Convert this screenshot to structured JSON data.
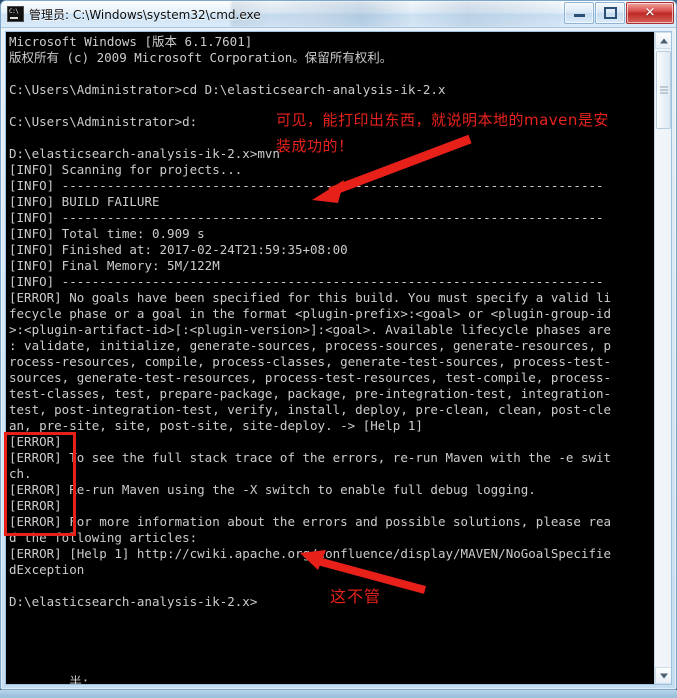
{
  "window": {
    "title": "管理员: C:\\Windows\\system32\\cmd.exe",
    "icon": "cmd-icon",
    "buttons": {
      "minimize": "—",
      "maximize": "□",
      "close": "✕"
    }
  },
  "console": {
    "lines": [
      "Microsoft Windows [版本 6.1.7601]",
      "版权所有 (c) 2009 Microsoft Corporation。保留所有权利。",
      "",
      "C:\\Users\\Administrator>cd D:\\elasticsearch-analysis-ik-2.x",
      "",
      "C:\\Users\\Administrator>d:",
      "",
      "D:\\elasticsearch-analysis-ik-2.x>mvn",
      "[INFO] Scanning for projects...",
      "[INFO] ------------------------------------------------------------------------",
      "[INFO] BUILD FAILURE",
      "[INFO] ------------------------------------------------------------------------",
      "[INFO] Total time: 0.909 s",
      "[INFO] Finished at: 2017-02-24T21:59:35+08:00",
      "[INFO] Final Memory: 5M/122M",
      "[INFO] ------------------------------------------------------------------------",
      "[ERROR] No goals have been specified for this build. You must specify a valid li",
      "fecycle phase or a goal in the format <plugin-prefix>:<goal> or <plugin-group-id",
      ">:<plugin-artifact-id>[:<plugin-version>]:<goal>. Available lifecycle phases are",
      ": validate, initialize, generate-sources, process-sources, generate-resources, p",
      "rocess-resources, compile, process-classes, generate-test-sources, process-test-",
      "sources, generate-test-resources, process-test-resources, test-compile, process-",
      "test-classes, test, prepare-package, package, pre-integration-test, integration-",
      "test, post-integration-test, verify, install, deploy, pre-clean, clean, post-cle",
      "an, pre-site, site, post-site, site-deploy. -> [Help 1]",
      "[ERROR]",
      "[ERROR] To see the full stack trace of the errors, re-run Maven with the -e swit",
      "ch.",
      "[ERROR] Re-run Maven using the -X switch to enable full debug logging.",
      "[ERROR]",
      "[ERROR] For more information about the errors and possible solutions, please rea",
      "d the following articles:",
      "[ERROR] [Help 1] http://cwiki.apache.org/confluence/display/MAVEN/NoGoalSpecifie",
      "dException",
      "",
      "D:\\elasticsearch-analysis-ik-2.x>",
      "",
      "",
      "",
      "",
      "        半:"
    ]
  },
  "annotations": {
    "note_top": "可见，能打印出东西，就说明本地的maven是安\n装成功的！",
    "note_bottom": "这不管",
    "color": "#e8201a"
  },
  "scrollbar": {
    "up_arrow": "▲",
    "down_arrow": "▼"
  }
}
